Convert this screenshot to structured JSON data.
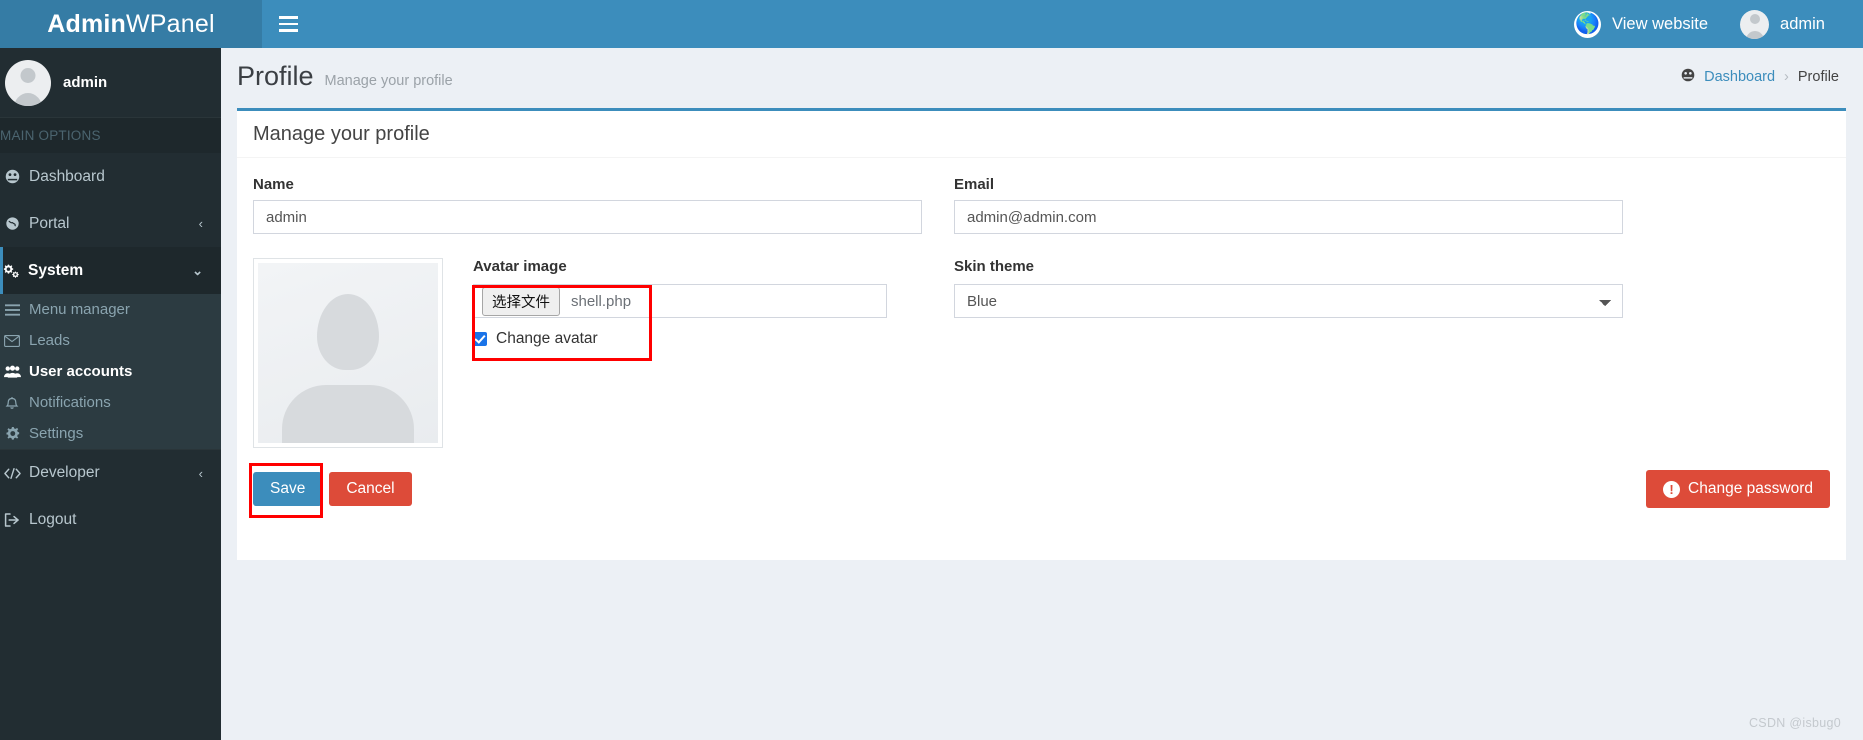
{
  "brand": {
    "bold": "Admin",
    "light": "WPanel"
  },
  "topbar": {
    "view_website": "View website",
    "user": "admin",
    "globe_icon": "globe-icon",
    "avatar_icon": "user-avatar-icon",
    "menu_toggle_icon": "hamburger-icon"
  },
  "sidebar": {
    "user_name": "admin",
    "section_header": "MAIN OPTIONS",
    "items": [
      {
        "label": "Dashboard",
        "icon": "dashboard-icon",
        "glyph": "⚇",
        "chevron": "",
        "active": false
      },
      {
        "label": "Portal",
        "icon": "globe-icon",
        "glyph": "ⓘ",
        "chevron": "‹",
        "active": false
      },
      {
        "label": "System",
        "icon": "gears-icon",
        "glyph": "⚙",
        "chevron": "⌄",
        "active": true
      }
    ],
    "sub_items": [
      {
        "label": "Menu manager",
        "icon": "bars-icon",
        "glyph": "☰",
        "selected": false
      },
      {
        "label": "Leads",
        "icon": "envelope-icon",
        "glyph": "✉",
        "selected": false
      },
      {
        "label": "User accounts",
        "icon": "users-icon",
        "glyph": "👥",
        "selected": true
      },
      {
        "label": "Notifications",
        "icon": "bell-icon",
        "glyph": "🔔",
        "selected": false
      },
      {
        "label": "Settings",
        "icon": "gear-icon",
        "glyph": "⚙",
        "selected": false
      }
    ],
    "bottom_items": [
      {
        "label": "Developer",
        "icon": "code-icon",
        "glyph": "‹/›",
        "chevron": "‹"
      },
      {
        "label": "Logout",
        "icon": "sign-out-icon",
        "glyph": "➡",
        "chevron": ""
      }
    ]
  },
  "page": {
    "title": "Profile",
    "subtitle": "Manage your profile",
    "breadcrumb": {
      "home_icon": "dashboard-icon",
      "home": "Dashboard",
      "separator": "›",
      "current": "Profile"
    }
  },
  "card": {
    "title": "Manage your profile",
    "name_label": "Name",
    "name_value": "admin",
    "email_label": "Email",
    "email_value": "admin@admin.com",
    "avatar_label": "Avatar image",
    "file_button": "选择文件",
    "file_name": "shell.php",
    "change_avatar_label": "Change avatar",
    "change_avatar_checked": true,
    "skin_label": "Skin theme",
    "skin_value": "Blue",
    "skin_options": [
      "Blue"
    ],
    "avatar_placeholder_icon": "user-placeholder-icon"
  },
  "actions": {
    "save": "Save",
    "cancel": "Cancel",
    "change_password": "Change password",
    "change_password_icon": "exclamation-circle-icon"
  },
  "watermark": "CSDN @isbug0",
  "colors": {
    "brand_blue": "#3c8dbc",
    "brand_blue_dark": "#357ca5",
    "sidebar_dark": "#222d32",
    "sidebar_submenu": "#2c3b41",
    "danger_red": "#dd4b39",
    "annotation_red": "#ff0000",
    "body_bg": "#ecf0f5"
  }
}
